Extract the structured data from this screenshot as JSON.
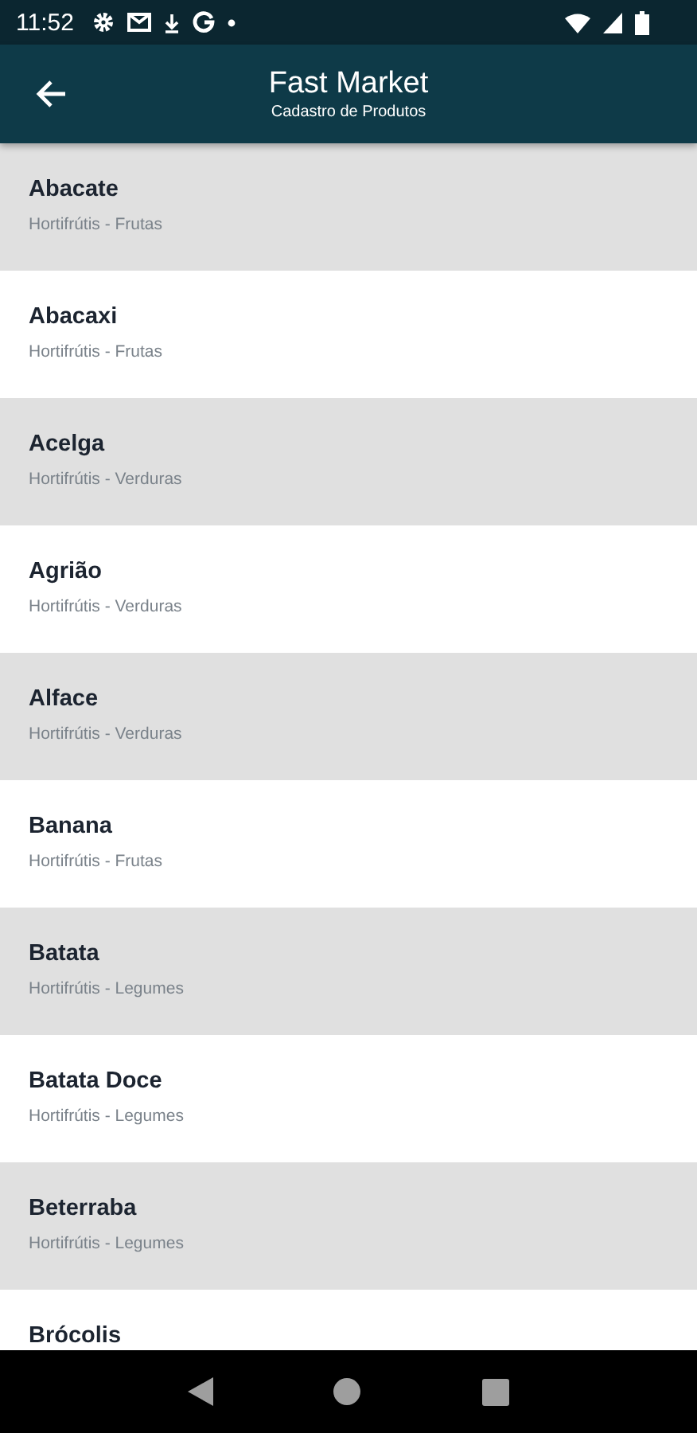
{
  "status_bar": {
    "time": "11:52"
  },
  "app_bar": {
    "title": "Fast Market",
    "subtitle": "Cadastro de Produtos"
  },
  "products": [
    {
      "name": "Abacate",
      "category": "Hortifrútis - Frutas"
    },
    {
      "name": "Abacaxi",
      "category": "Hortifrútis - Frutas"
    },
    {
      "name": "Acelga",
      "category": "Hortifrútis - Verduras"
    },
    {
      "name": "Agrião",
      "category": "Hortifrútis - Verduras"
    },
    {
      "name": "Alface",
      "category": "Hortifrútis - Verduras"
    },
    {
      "name": "Banana",
      "category": "Hortifrútis - Frutas"
    },
    {
      "name": "Batata",
      "category": "Hortifrútis - Legumes"
    },
    {
      "name": "Batata Doce",
      "category": "Hortifrútis - Legumes"
    },
    {
      "name": "Beterraba",
      "category": "Hortifrútis - Legumes"
    },
    {
      "name": "Brócolis"
    }
  ]
}
